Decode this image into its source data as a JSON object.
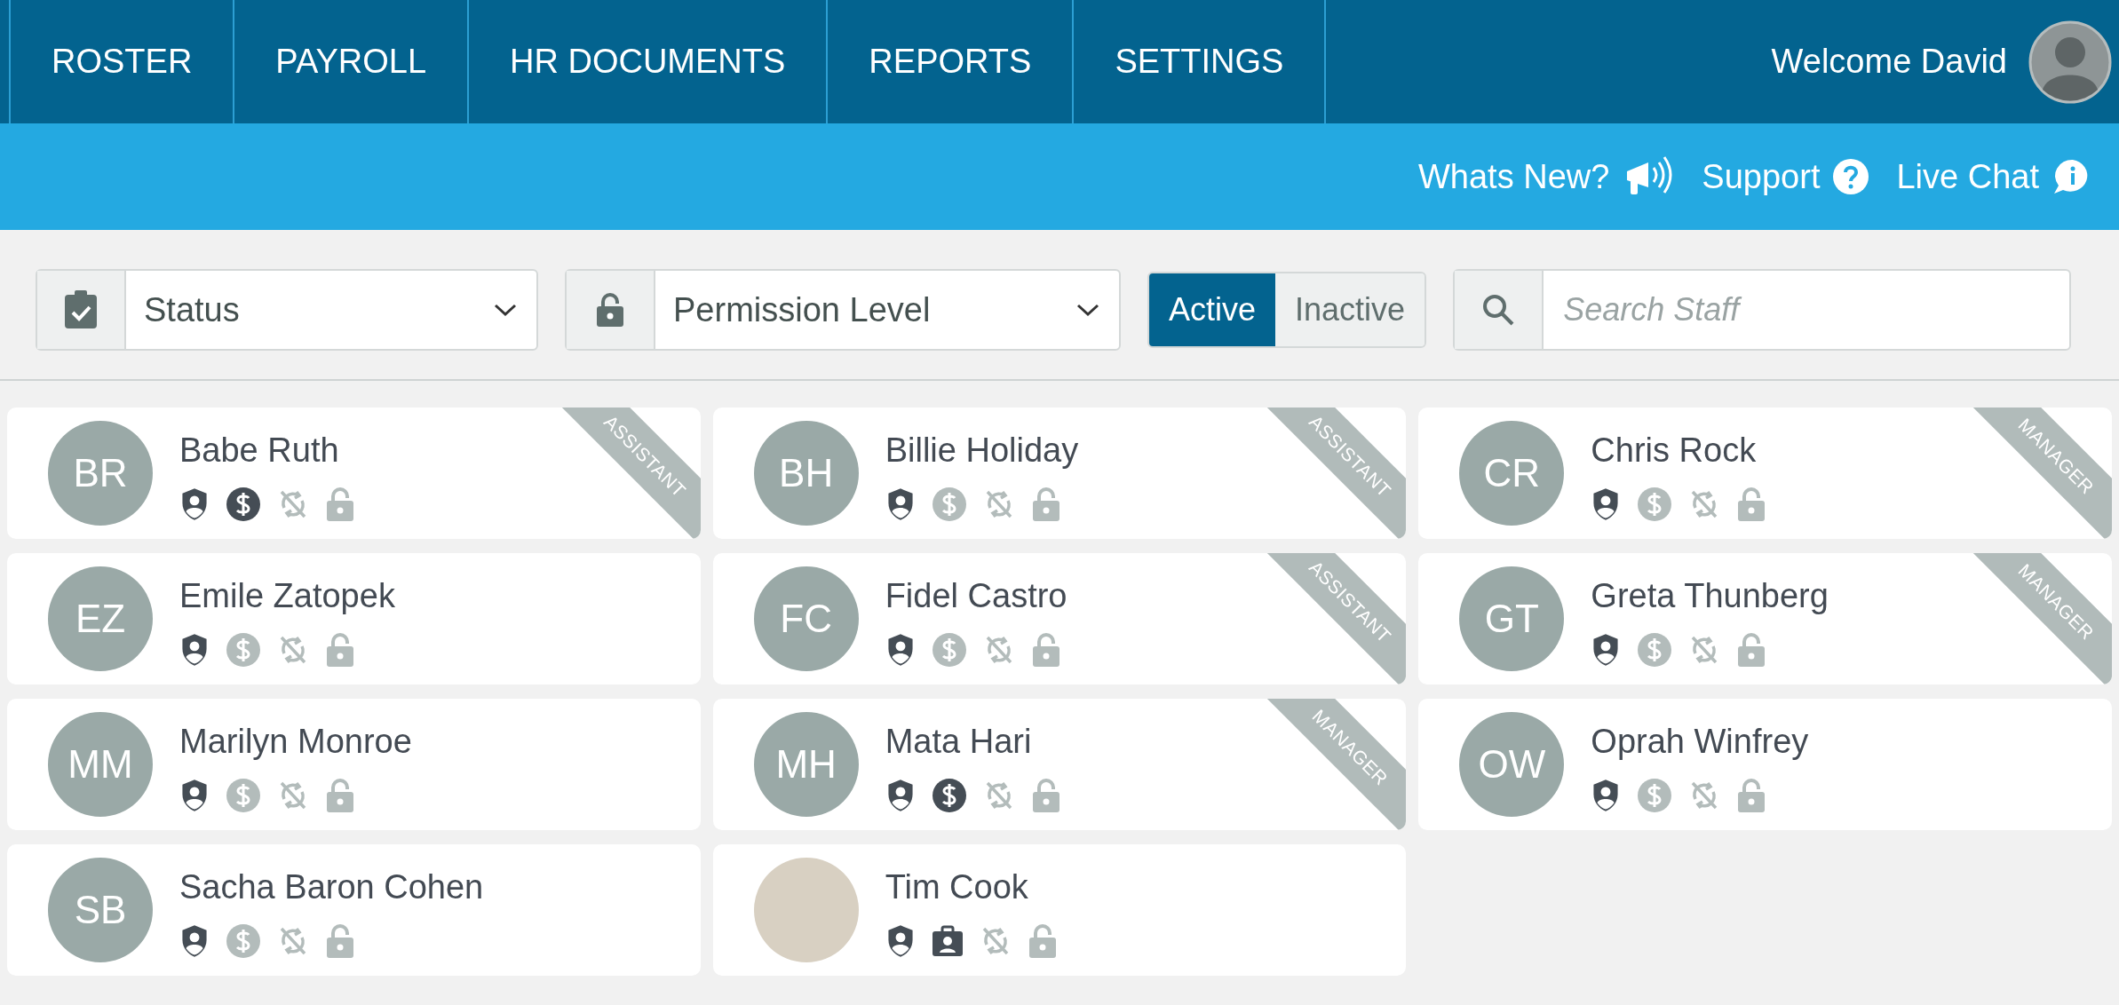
{
  "nav": {
    "tabs": [
      {
        "label": "ROSTER"
      },
      {
        "label": "PAYROLL"
      },
      {
        "label": "HR DOCUMENTS"
      },
      {
        "label": "REPORTS"
      },
      {
        "label": "SETTINGS"
      }
    ],
    "welcome": "Welcome David"
  },
  "subnav": {
    "links": [
      {
        "label": "Whats New?",
        "kind": "megaphone"
      },
      {
        "label": "Support",
        "kind": "question"
      },
      {
        "label": "Live Chat",
        "kind": "chat"
      }
    ]
  },
  "filters": {
    "status": {
      "value": "Status"
    },
    "permission": {
      "value": "Permission Level"
    },
    "toggle": [
      {
        "label": "Active",
        "selected": true
      },
      {
        "label": "Inactive",
        "selected": false
      }
    ],
    "search": {
      "placeholder": "Search Staff"
    }
  },
  "staff": [
    {
      "name": "Babe Ruth",
      "avatar": {
        "kind": "initials",
        "initials": "BR"
      },
      "payroll": {
        "kind": "dollar",
        "active": true
      },
      "role": "ASSISTANT"
    },
    {
      "name": "Billie Holiday",
      "avatar": {
        "kind": "initials",
        "initials": "BH"
      },
      "payroll": {
        "kind": "dollar",
        "active": false
      },
      "role": "ASSISTANT"
    },
    {
      "name": "Chris Rock",
      "avatar": {
        "kind": "initials",
        "initials": "CR"
      },
      "payroll": {
        "kind": "dollar",
        "active": false
      },
      "role": "MANAGER"
    },
    {
      "name": "Emile Zatopek",
      "avatar": {
        "kind": "initials",
        "initials": "EZ"
      },
      "payroll": {
        "kind": "dollar",
        "active": false
      }
    },
    {
      "name": "Fidel Castro",
      "avatar": {
        "kind": "initials",
        "initials": "FC"
      },
      "payroll": {
        "kind": "dollar",
        "active": false
      },
      "role": "ASSISTANT"
    },
    {
      "name": "Greta Thunberg",
      "avatar": {
        "kind": "initials",
        "initials": "GT"
      },
      "payroll": {
        "kind": "dollar",
        "active": false
      },
      "role": "MANAGER"
    },
    {
      "name": "Marilyn Monroe",
      "avatar": {
        "kind": "initials",
        "initials": "MM"
      },
      "payroll": {
        "kind": "dollar",
        "active": false
      }
    },
    {
      "name": "Mata Hari",
      "avatar": {
        "kind": "initials",
        "initials": "MH"
      },
      "payroll": {
        "kind": "dollar",
        "active": true
      },
      "role": "MANAGER"
    },
    {
      "name": "Oprah Winfrey",
      "avatar": {
        "kind": "initials",
        "initials": "OW"
      },
      "payroll": {
        "kind": "dollar",
        "active": false
      }
    },
    {
      "name": "Sacha Baron Cohen",
      "avatar": {
        "kind": "initials",
        "initials": "SB"
      },
      "payroll": {
        "kind": "dollar",
        "active": false
      }
    },
    {
      "name": "Tim Cook",
      "avatar": {
        "kind": "photo"
      },
      "payroll": {
        "kind": "badge",
        "active": true
      }
    }
  ]
}
